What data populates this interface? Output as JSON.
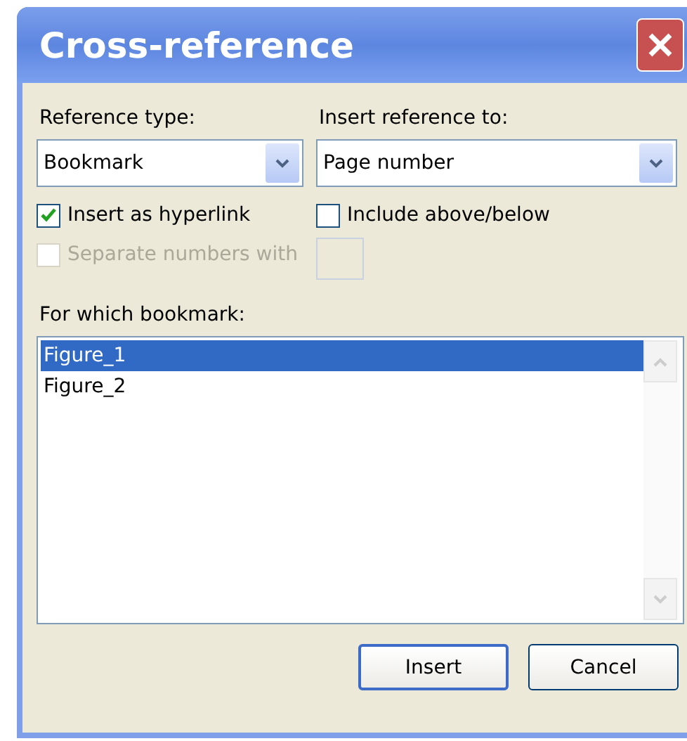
{
  "window": {
    "title": "Cross-reference"
  },
  "reference_type": {
    "label": "Reference type:",
    "value": "Bookmark"
  },
  "insert_reference_to": {
    "label": "Insert reference to:",
    "value": "Page number"
  },
  "checkboxes": [
    {
      "label": "Insert as hyperlink",
      "checked": true,
      "disabled": false
    },
    {
      "label": "Include above/below",
      "checked": false,
      "disabled": false
    },
    {
      "label": "Separate numbers with",
      "checked": false,
      "disabled": true
    }
  ],
  "list": {
    "label": "For which bookmark:",
    "items": [
      {
        "label": "Figure_1",
        "selected": true
      },
      {
        "label": "Figure_2",
        "selected": false
      }
    ]
  },
  "buttons": [
    {
      "label": "Insert",
      "default": true
    },
    {
      "label": "Cancel",
      "default": false
    }
  ]
}
